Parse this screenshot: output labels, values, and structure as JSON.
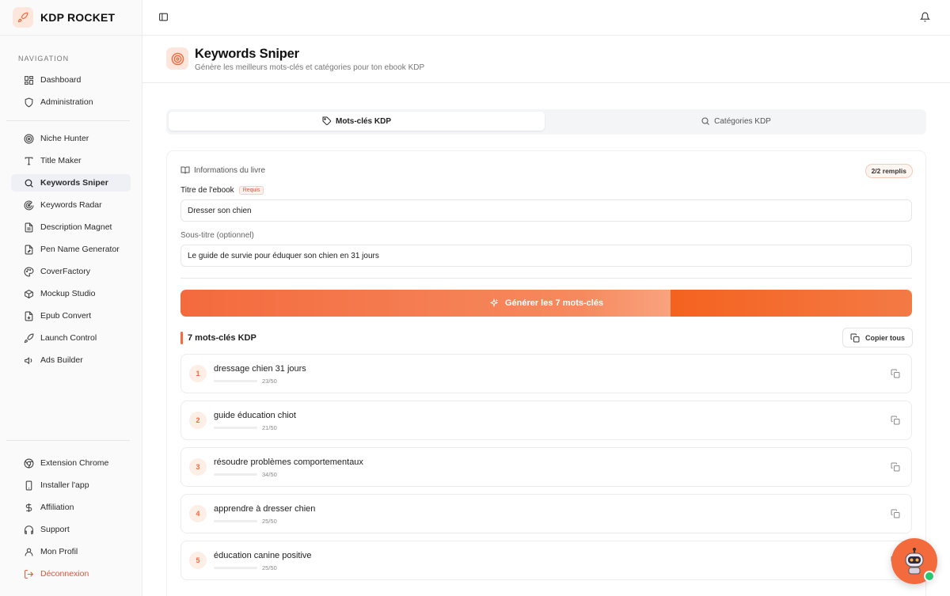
{
  "app": {
    "name": "KDP ROCKET"
  },
  "sidebar": {
    "section_label": "NAVIGATION",
    "admin_items": [
      {
        "label": "Dashboard",
        "icon": "grid-icon"
      },
      {
        "label": "Administration",
        "icon": "shield-icon"
      }
    ],
    "tool_items": [
      {
        "label": "Niche Hunter",
        "icon": "target-icon"
      },
      {
        "label": "Title Maker",
        "icon": "text-icon"
      },
      {
        "label": "Keywords Sniper",
        "icon": "search-icon",
        "active": true
      },
      {
        "label": "Keywords Radar",
        "icon": "radar-icon"
      },
      {
        "label": "Description Magnet",
        "icon": "file-text-icon"
      },
      {
        "label": "Pen Name Generator",
        "icon": "pen-icon"
      },
      {
        "label": "CoverFactory",
        "icon": "palette-icon"
      },
      {
        "label": "Mockup Studio",
        "icon": "box-icon"
      },
      {
        "label": "Epub Convert",
        "icon": "file-convert-icon"
      },
      {
        "label": "Launch Control",
        "icon": "rocket-icon"
      },
      {
        "label": "Ads Builder",
        "icon": "megaphone-icon"
      }
    ],
    "footer_items": [
      {
        "label": "Extension Chrome",
        "icon": "chrome-icon"
      },
      {
        "label": "Installer l'app",
        "icon": "smartphone-icon"
      },
      {
        "label": "Affiliation",
        "icon": "dollar-icon"
      },
      {
        "label": "Support",
        "icon": "headphones-icon"
      },
      {
        "label": "Mon Profil",
        "icon": "user-icon"
      },
      {
        "label": "Déconnexion",
        "icon": "logout-icon"
      }
    ]
  },
  "header": {
    "title": "Keywords Sniper",
    "subtitle": "Génère les meilleurs mots-clés et catégories pour ton ebook KDP"
  },
  "tabs": [
    {
      "label": "Mots-clés KDP",
      "active": true
    },
    {
      "label": "Catégories KDP",
      "active": false
    }
  ],
  "form": {
    "section_title": "Informations du livre",
    "filled_badge": "2/2 remplis",
    "title_label": "Titre de l'ebook",
    "required_badge": "Requis",
    "title_value": "Dresser son chien",
    "subtitle_label": "Sous-titre (optionnel)",
    "subtitle_value": "Le guide de survie pour éduquer son chien en 31 jours",
    "generate_button": "Générer les 7 mots-clés"
  },
  "keywords": {
    "heading": "7 mots-clés KDP",
    "copy_all": "Copier tous",
    "max_length": 50,
    "items": [
      {
        "num": "1",
        "text": "dressage chien 31 jours",
        "count": "23/50",
        "length": 23
      },
      {
        "num": "2",
        "text": "guide éducation chiot",
        "count": "21/50",
        "length": 21
      },
      {
        "num": "3",
        "text": "résoudre problèmes comportementaux",
        "count": "34/50",
        "length": 34
      },
      {
        "num": "4",
        "text": "apprendre à dresser chien",
        "count": "25/50",
        "length": 25
      },
      {
        "num": "5",
        "text": "éducation canine positive",
        "count": "25/50",
        "length": 25
      }
    ]
  },
  "colors": {
    "accent": "#f36a3d",
    "logout": "#e5533b",
    "online": "#28c76f"
  }
}
